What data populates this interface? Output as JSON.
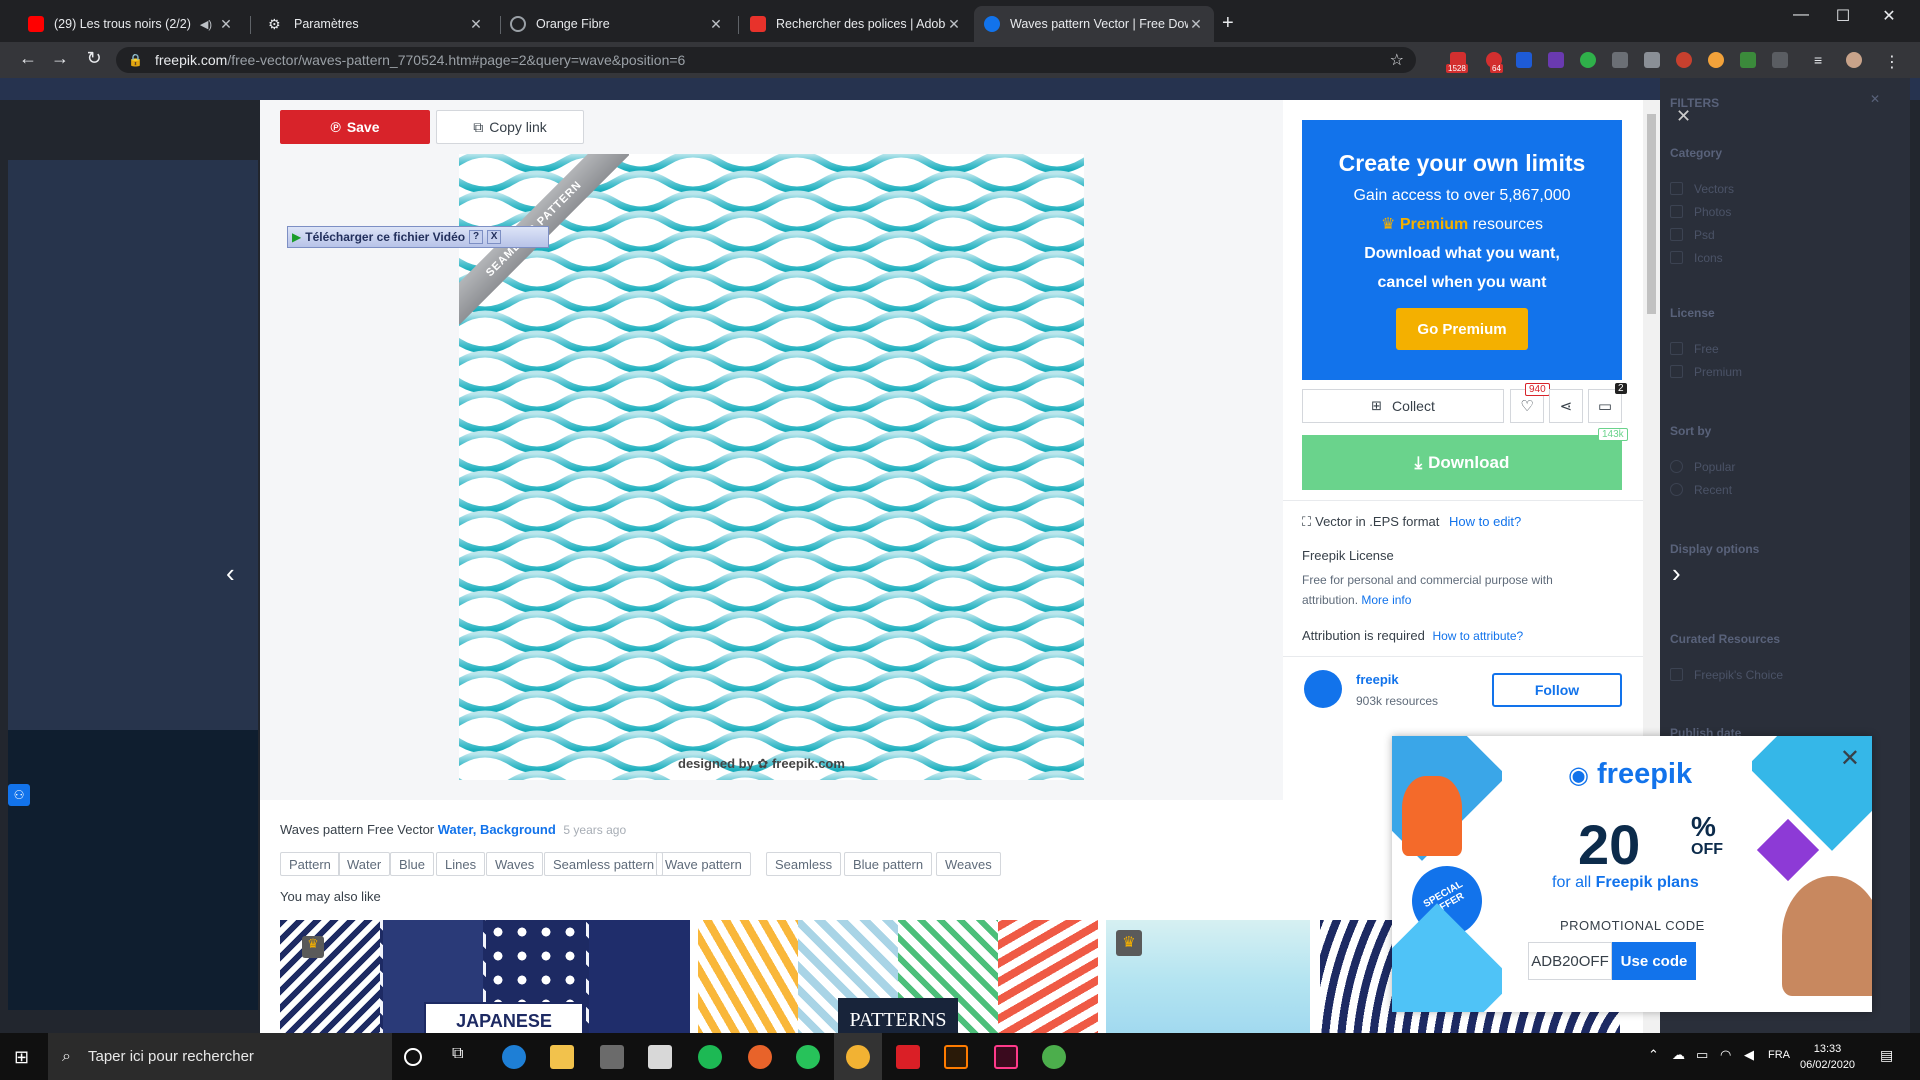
{
  "browser": {
    "tabs": [
      {
        "title": "(29) Les trous noirs (2/2) - 4",
        "favicon_color": "#ff0000"
      },
      {
        "title": "Paramètres",
        "favicon_color": "#9aa0a6"
      },
      {
        "title": "Orange Fibre",
        "favicon_color": "#9aa0a6"
      },
      {
        "title": "Rechercher des polices | Adobe F",
        "favicon_color": "#e8322b"
      },
      {
        "title": "Waves pattern Vector | Free Dow",
        "favicon_color": "#1273eb"
      }
    ],
    "new_tab": "+",
    "url_host": "freepik.com",
    "url_path": "/free-vector/waves-pattern_770524.htm#page=2&query=wave&position=6",
    "ext_badges": [
      "1528",
      "64"
    ]
  },
  "filters_panel": {
    "title": "FILTERS",
    "category": {
      "heading": "Category",
      "items": [
        "Vectors",
        "Photos",
        "Psd",
        "Icons"
      ]
    },
    "license": {
      "heading": "License",
      "items": [
        "Free",
        "Premium"
      ]
    },
    "sort": {
      "heading": "Sort by",
      "items": [
        "Popular",
        "Recent"
      ]
    },
    "display": {
      "heading": "Display options"
    },
    "curated": {
      "heading": "Curated Resources",
      "items": [
        "Freepik's Choice"
      ]
    },
    "publish": {
      "heading": "Publish date"
    }
  },
  "modal": {
    "save_label": "Save",
    "copy_label": "Copy link",
    "ribbon_text": "SEAMLESS PATTERN",
    "video_bar": {
      "label": "Télécharger ce fichier Vidéo",
      "help": "?",
      "close": "X"
    },
    "watermark": "designed by ✿ freepik.com",
    "promo": {
      "title": "Create your own limits",
      "line1": "Gain access to over 5,867,000",
      "premium_word": "Premium",
      "line2_suffix": " resources",
      "line3": "Download what you want,",
      "line4": "cancel when you want",
      "button": "Go Premium"
    },
    "collect_label": "Collect",
    "likes": "940",
    "comments": "2",
    "download_count": "143k",
    "download_label": "Download",
    "format_text": "Vector in .EPS format",
    "how_to_edit": "How to edit?",
    "license_title": "Freepik License",
    "license_text": "Free for personal and commercial purpose with attribution.",
    "more_info": "More info",
    "attribution_text": "Attribution is required",
    "how_to_attribute": "How to attribute?",
    "author": {
      "name": "freepik",
      "resources": "903k resources",
      "follow": "Follow"
    },
    "caption": {
      "text": "Waves pattern Free Vector",
      "links": [
        "Water",
        "Background"
      ],
      "age": "5 years ago"
    },
    "tags": [
      "Pattern",
      "Water",
      "Blue",
      "Lines",
      "Waves",
      "Seamless pattern",
      "Wave pattern",
      "Seamless",
      "Blue pattern",
      "Weaves"
    ],
    "related_title": "You may also like",
    "thumb_labels": [
      "JAPANESE",
      "PATTERNS"
    ]
  },
  "ad": {
    "brand": "freepik",
    "percent": "20",
    "percent_sign": "%",
    "off": "OFF",
    "plans_prefix": "for all ",
    "plans_link": "Freepik plans",
    "promo_label": "PROMOTIONAL CODE",
    "code": "ADB20OFF",
    "use": "Use code",
    "badge": "SPECIAL OFFER"
  },
  "taskbar": {
    "search_placeholder": "Taper ici pour rechercher",
    "lang": "FRA",
    "time": "13:33",
    "date": "06/02/2020"
  },
  "colors": {
    "accent": "#1273eb",
    "download": "#6ad38c",
    "save": "#d8232a",
    "premium_btn": "#f4b000"
  }
}
